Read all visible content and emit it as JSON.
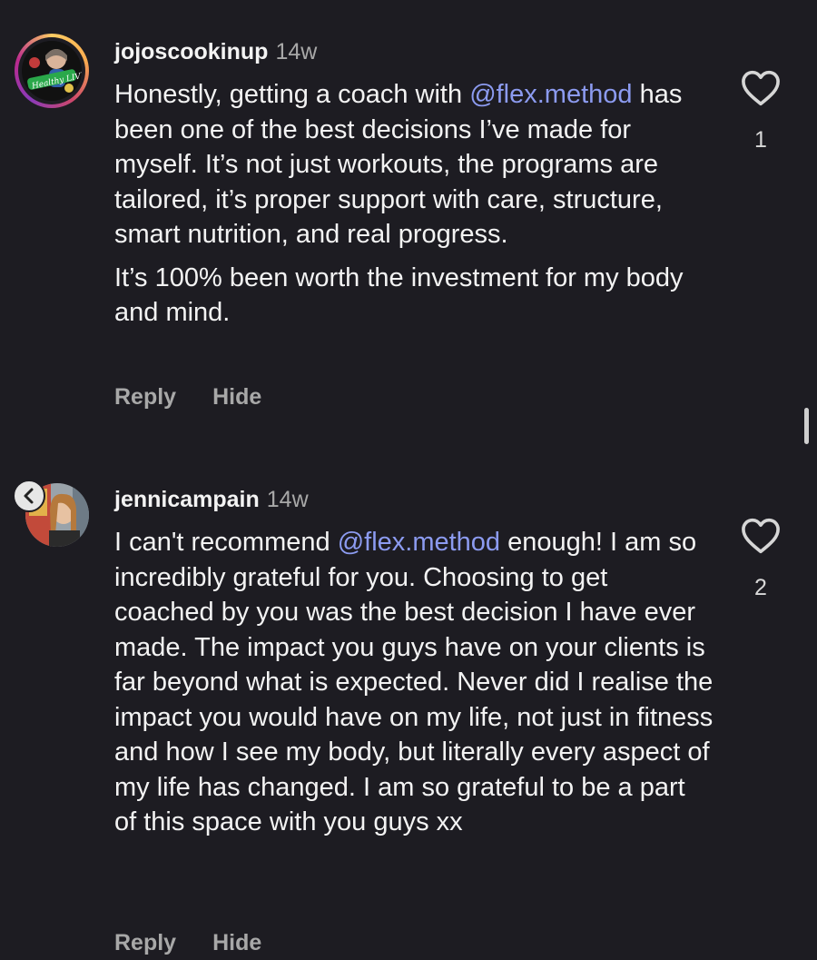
{
  "comments": [
    {
      "username": "jojoscookinup",
      "time": "14w",
      "avatar_text": "Healthy LIVING",
      "paragraphs": [
        {
          "pre": "Honestly, getting a coach with ",
          "mention": "@flex.method",
          "post": " has been one of the best decisions I’ve made for myself. It’s not just workouts, the programs are tailored, it’s proper support with care, structure, smart nutrition, and real progress."
        },
        {
          "pre": "It’s 100% been worth the investment for my body and mind.",
          "mention": "",
          "post": ""
        }
      ],
      "reply_label": "Reply",
      "hide_label": "Hide",
      "like_count": "1"
    },
    {
      "username": "jennicampain",
      "time": "14w",
      "paragraphs": [
        {
          "pre": "I can't recommend ",
          "mention": "@flex.method",
          "post": " enough! I am so incredibly grateful for you. Choosing to get coached by you was the best decision I have ever made. The impact you guys have on your clients is far beyond what is expected. Never did I realise the impact you would have on my life, not just in fitness and how I see my body, but literally every aspect of my life has changed. I am so grateful to be a part of this space with you guys xx"
        }
      ],
      "reply_label": "Reply",
      "hide_label": "Hide",
      "like_count": "2"
    }
  ],
  "colors": {
    "background": "#1d1c22",
    "text": "#f3f3f3",
    "secondary": "#a8a8a8",
    "mention": "#8c9bf0",
    "story_ring": [
      "#fccc63",
      "#cd486b",
      "#8a3ab9"
    ]
  },
  "icons": {
    "like": "heart-outline-icon",
    "back": "chevron-left-icon"
  }
}
